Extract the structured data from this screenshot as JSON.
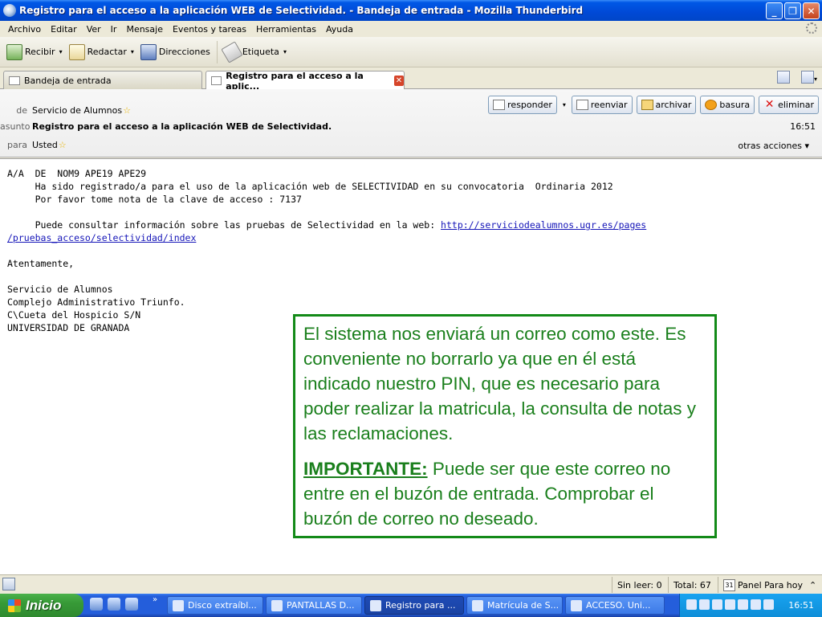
{
  "window": {
    "title": "Registro para el acceso a la aplicación WEB de Selectividad. - Bandeja de entrada - Mozilla Thunderbird",
    "minimize": "_",
    "maximize": "❐",
    "close": "✕"
  },
  "menubar": [
    "Archivo",
    "Editar",
    "Ver",
    "Ir",
    "Mensaje",
    "Eventos y tareas",
    "Herramientas",
    "Ayuda"
  ],
  "toolbar": {
    "receive": "Recibir",
    "compose": "Redactar",
    "addressbook": "Direcciones",
    "tag": "Etiqueta"
  },
  "tabs": [
    {
      "label": "Bandeja de entrada"
    },
    {
      "label": "Registro para el acceso a la aplic..."
    }
  ],
  "header": {
    "from_label": "de",
    "from": "Servicio de Alumnos",
    "subject_label": "asunto",
    "subject": "Registro para el acceso a la aplicación WEB de Selectividad.",
    "to_label": "para",
    "to": "Usted",
    "time": "16:51",
    "more_actions": "otras acciones ▾",
    "actions": {
      "reply": "responder",
      "forward": "reenviar",
      "archive": "archivar",
      "junk": "basura",
      "delete": "eliminar"
    }
  },
  "body": {
    "lines": [
      "A/A  DE  NOM9 APE19 APE29",
      "     Ha sido registrado/a para el uso de la aplicación web de SELECTIVIDAD en su convocatoria  Ordinaria 2012",
      "     Por favor tome nota de la clave de acceso : 7137",
      "",
      "     Puede consultar información sobre las pruebas de Selectividad en la web: "
    ],
    "link_part1": "http://serviciodealumnos.ugr.es/pages",
    "link_part2": "/pruebas_acceso/selectividad/index",
    "closing_lines": [
      "",
      "Atentamente,",
      "",
      "Servicio de Alumnos",
      "Complejo Administrativo Triunfo.",
      "C\\Cueta del Hospicio S/N",
      "UNIVERSIDAD DE GRANADA"
    ]
  },
  "note": {
    "paragraph1": "El sistema nos enviará un correo como este. Es conveniente no borrarlo ya que en él está indicado nuestro PIN, que es necesario para poder realizar la matricula, la consulta de notas y las reclamaciones.",
    "important_label": "IMPORTANTE:",
    "paragraph2": " Puede ser que este correo no entre en el buzón de entrada. Comprobar el buzón de correo no deseado."
  },
  "statusbar": {
    "unread": "Sin leer: 0",
    "total": "Total: 67",
    "panel": "Panel Para hoy",
    "calendar_day": "31",
    "toggle": "⌃"
  },
  "taskbar": {
    "start": "Inicio",
    "quicklaunch_more": "»",
    "tasks": [
      "Disco extraíbl...",
      "PANTALLAS D...",
      "Registro para ...",
      "Matrícula de S...",
      "ACCESO. Uni..."
    ],
    "clock": "16:51"
  }
}
